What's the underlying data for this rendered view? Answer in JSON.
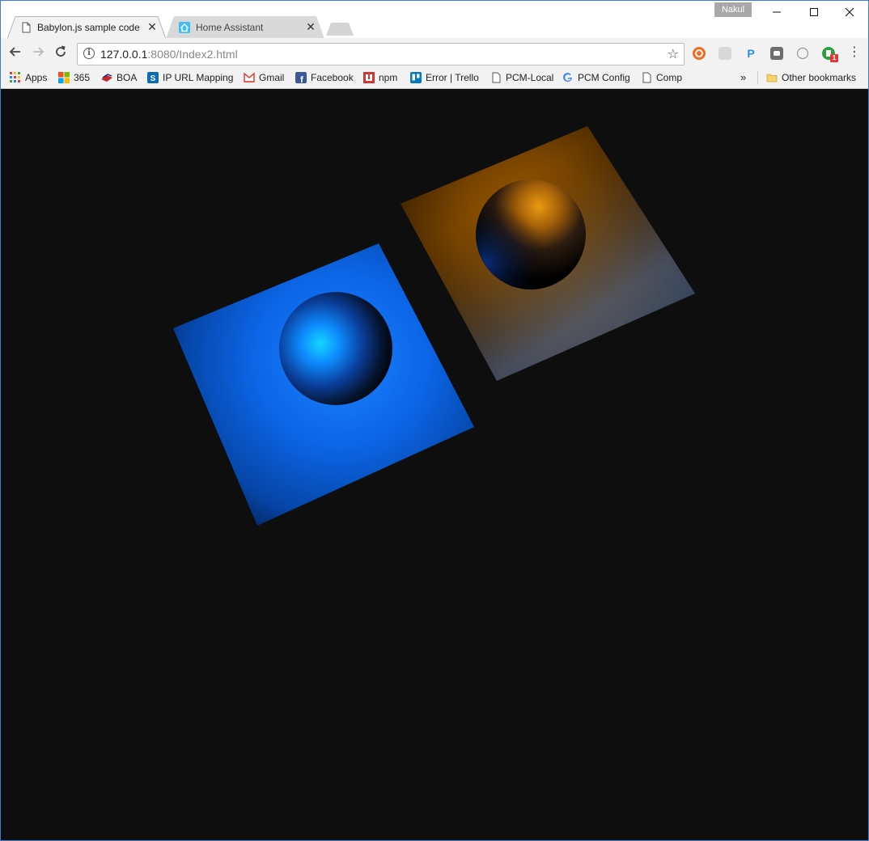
{
  "tabs": [
    {
      "title": "Babylon.js sample code",
      "active": true,
      "close": "✕"
    },
    {
      "title": "Home Assistant",
      "active": false,
      "close": "✕"
    }
  ],
  "profile": {
    "name": "Nakul"
  },
  "window_controls": {
    "minimize": "—",
    "maximize": "☐",
    "close": "✕"
  },
  "toolbar": {
    "back": "←",
    "forward": "→",
    "reload": "↻",
    "info": "i",
    "url_host": "127.0.0.1",
    "url_rest": ":8080/Index2.html",
    "star": "☆",
    "menu": "⋮",
    "ext_badge": "1"
  },
  "bookmarks": {
    "items": [
      {
        "label": "Apps"
      },
      {
        "label": "365"
      },
      {
        "label": "BOA"
      },
      {
        "label": "IP URL Mapping"
      },
      {
        "label": "Gmail"
      },
      {
        "label": "Facebook"
      },
      {
        "label": "npm"
      },
      {
        "label": "Error | Trello"
      },
      {
        "label": "PCM-Local"
      },
      {
        "label": "PCM Config"
      },
      {
        "label": "Comp"
      }
    ],
    "overflow": "»",
    "other": "Other bookmarks"
  },
  "scene": {
    "background": "#0e0e0e",
    "blue_light": "#1a7cff",
    "orange_light": "#e08a00"
  }
}
